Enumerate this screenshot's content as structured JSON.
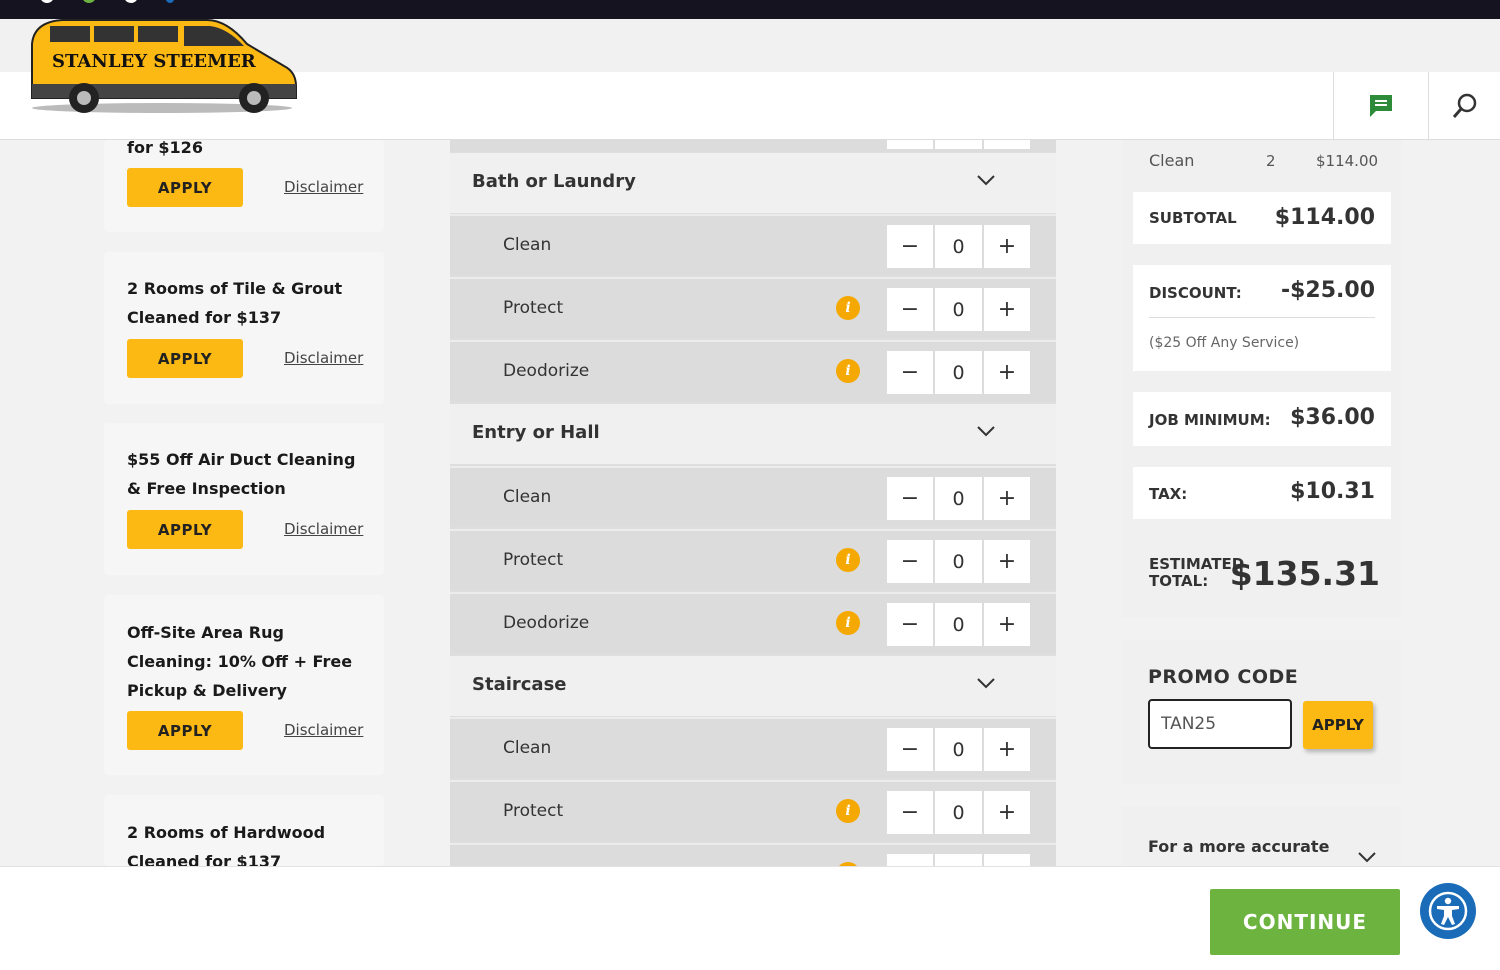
{
  "brand": {
    "name": "STANLEY STEEMER",
    "accent": "#fdb913",
    "green": "#6cb33f"
  },
  "header": {
    "chat_icon": "chat-icon",
    "search_icon": "search-icon"
  },
  "promos": [
    {
      "title": "for $126",
      "apply": "APPLY",
      "disclaimer": "Disclaimer"
    },
    {
      "title": "2 Rooms of Tile & Grout Cleaned for $137",
      "apply": "APPLY",
      "disclaimer": "Disclaimer"
    },
    {
      "title": "$55 Off Air Duct Cleaning & Free Inspection",
      "apply": "APPLY",
      "disclaimer": "Disclaimer"
    },
    {
      "title": "Off-Site Area Rug Cleaning: 10% Off + Free Pickup & Delivery",
      "apply": "APPLY",
      "disclaimer": "Disclaimer"
    },
    {
      "title": "2 Rooms of Hardwood Cleaned for $137"
    }
  ],
  "sections": [
    {
      "name": "Bath or Laundry",
      "rows": [
        {
          "label": "Clean",
          "qty": "0"
        },
        {
          "label": "Protect",
          "qty": "0"
        },
        {
          "label": "Deodorize",
          "qty": "0"
        }
      ]
    },
    {
      "name": "Entry or Hall",
      "rows": [
        {
          "label": "Clean",
          "qty": "0"
        },
        {
          "label": "Protect",
          "qty": "0"
        },
        {
          "label": "Deodorize",
          "qty": "0"
        }
      ]
    },
    {
      "name": "Staircase",
      "rows": [
        {
          "label": "Clean",
          "qty": "0"
        },
        {
          "label": "Protect",
          "qty": "0"
        }
      ]
    }
  ],
  "stepper": {
    "minus": "−",
    "plus": "+",
    "info": "i"
  },
  "summary": {
    "line_item": {
      "label": "Clean",
      "qty": "2",
      "price": "$114.00"
    },
    "subtotal_label": "SUBTOTAL",
    "subtotal": "$114.00",
    "discount_label": "DISCOUNT:",
    "discount": "-$25.00",
    "discount_note": "($25 Off Any Service)",
    "job_min_label": "JOB MINIMUM:",
    "job_min": "$36.00",
    "tax_label": "TAX:",
    "tax": "$10.31",
    "est_label_1": "ESTIMATED",
    "est_label_2": "TOTAL:",
    "est_total": "$135.31"
  },
  "promo_code": {
    "title": "PROMO CODE",
    "value": "TAN25",
    "apply": "APPLY"
  },
  "accurate": {
    "text": "For a more accurate"
  },
  "footer": {
    "continue": "CONTINUE"
  }
}
